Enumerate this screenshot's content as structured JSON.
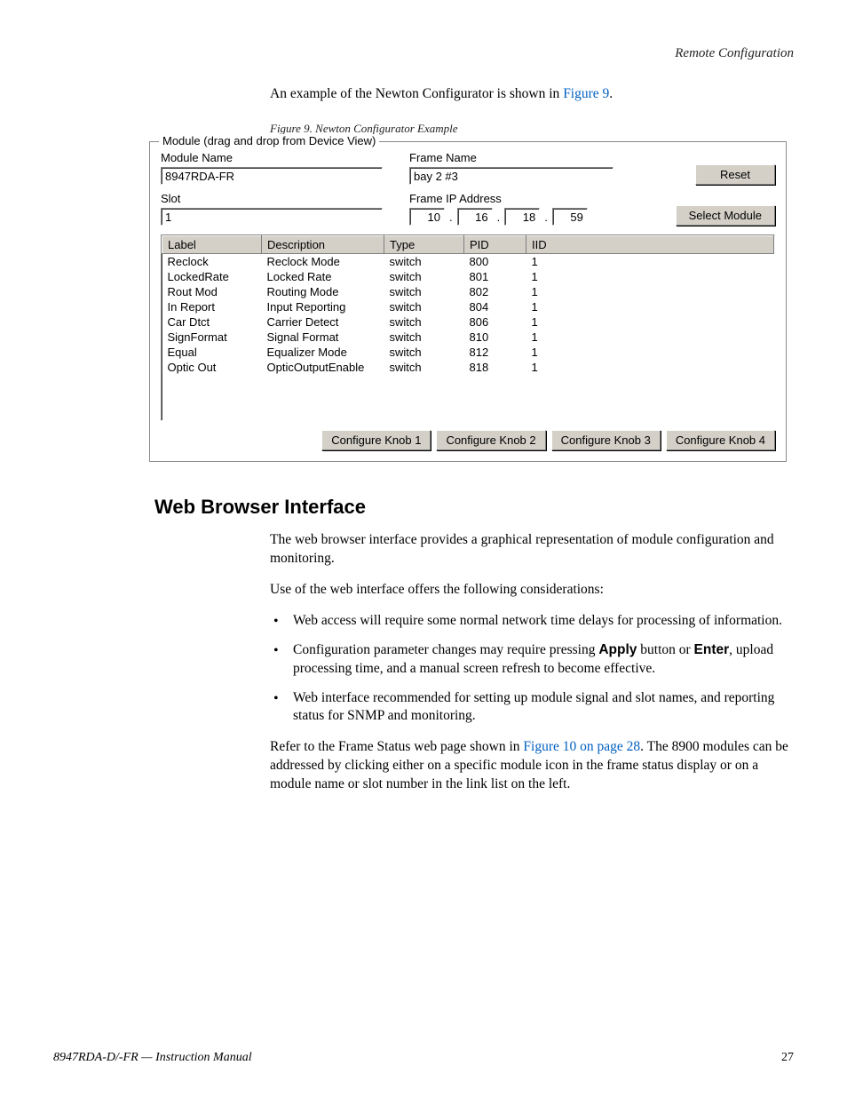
{
  "header": {
    "section": "Remote Configuration"
  },
  "intro": {
    "text_a": "An example of the Newton Configurator is shown in ",
    "link": "Figure 9",
    "text_b": "."
  },
  "figcaption": "Figure 9.  Newton Configurator Example",
  "newton": {
    "legend": "Module (drag and drop from Device View)",
    "modname_lbl": "Module Name",
    "modname_val": "8947RDA-FR",
    "framename_lbl": "Frame Name",
    "framename_val": "bay 2 #3",
    "slot_lbl": "Slot",
    "slot_val": "1",
    "frameip_lbl": "Frame IP Address",
    "ip": {
      "a": "10",
      "b": "16",
      "c": "18",
      "d": "59"
    },
    "reset_btn": "Reset",
    "select_btn": "Select Module",
    "cols": {
      "label": "Label",
      "desc": "Description",
      "type": "Type",
      "pid": "PID",
      "iid": "IID"
    },
    "rows": [
      {
        "label": "Reclock",
        "desc": "Reclock Mode",
        "type": "switch",
        "pid": "800",
        "iid": "1"
      },
      {
        "label": "LockedRate",
        "desc": "Locked Rate",
        "type": "switch",
        "pid": "801",
        "iid": "1"
      },
      {
        "label": "Rout Mod",
        "desc": "Routing Mode",
        "type": "switch",
        "pid": "802",
        "iid": "1"
      },
      {
        "label": "In Report",
        "desc": "Input Reporting",
        "type": "switch",
        "pid": "804",
        "iid": "1"
      },
      {
        "label": "Car Dtct",
        "desc": "Carrier Detect",
        "type": "switch",
        "pid": "806",
        "iid": "1"
      },
      {
        "label": "SignFormat",
        "desc": "Signal Format",
        "type": "switch",
        "pid": "810",
        "iid": "1"
      },
      {
        "label": "Equal",
        "desc": "Equalizer Mode",
        "type": "switch",
        "pid": "812",
        "iid": "1"
      },
      {
        "label": "Optic Out",
        "desc": "OpticOutputEnable",
        "type": "switch",
        "pid": "818",
        "iid": "1"
      }
    ],
    "knobs": [
      "Configure Knob 1",
      "Configure Knob 2",
      "Configure Knob 3",
      "Configure Knob 4"
    ]
  },
  "section_title": "Web Browser Interface",
  "p1": "The web browser interface provides a graphical representation of module configuration and monitoring.",
  "p2": "Use of the web interface offers the following considerations:",
  "bullets": {
    "b1": "Web access will require some normal network time delays for processing of information.",
    "b2a": "Configuration parameter changes may require pressing ",
    "b2_apply": "Apply",
    "b2b": " button or ",
    "b2_enter": "Enter",
    "b2c": ", upload processing time, and a manual screen refresh to become effective.",
    "b3": "Web interface recommended for setting up module signal and slot names, and reporting status for SNMP and monitoring."
  },
  "p3": {
    "a": "Refer to the Frame Status web page shown in ",
    "link": "Figure 10 on page 28",
    "b": ". The 8900 modules can be addressed by clicking either on a specific module icon in the frame status display or on a module name or slot number in the link list on the left."
  },
  "footer": {
    "left": "8947RDA-D/-FR — Instruction Manual",
    "page": "27"
  }
}
